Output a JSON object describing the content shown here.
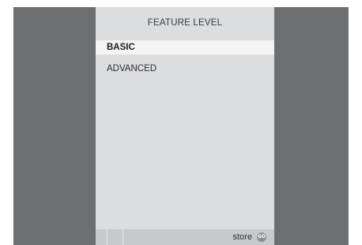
{
  "menu": {
    "title": "FEATURE LEVEL",
    "items": [
      {
        "label": "BASIC",
        "selected": true
      },
      {
        "label": "ADVANCED",
        "selected": false
      }
    ]
  },
  "footer": {
    "store_label": "store",
    "go_icon_text": "GO",
    "go_icon": "go-button-icon"
  },
  "colors": {
    "screen_background": "#6d6e70",
    "panel_background": "#dcdddf",
    "selected_row": "#f4f4f5",
    "footer_bar": "#c8c9cb"
  }
}
